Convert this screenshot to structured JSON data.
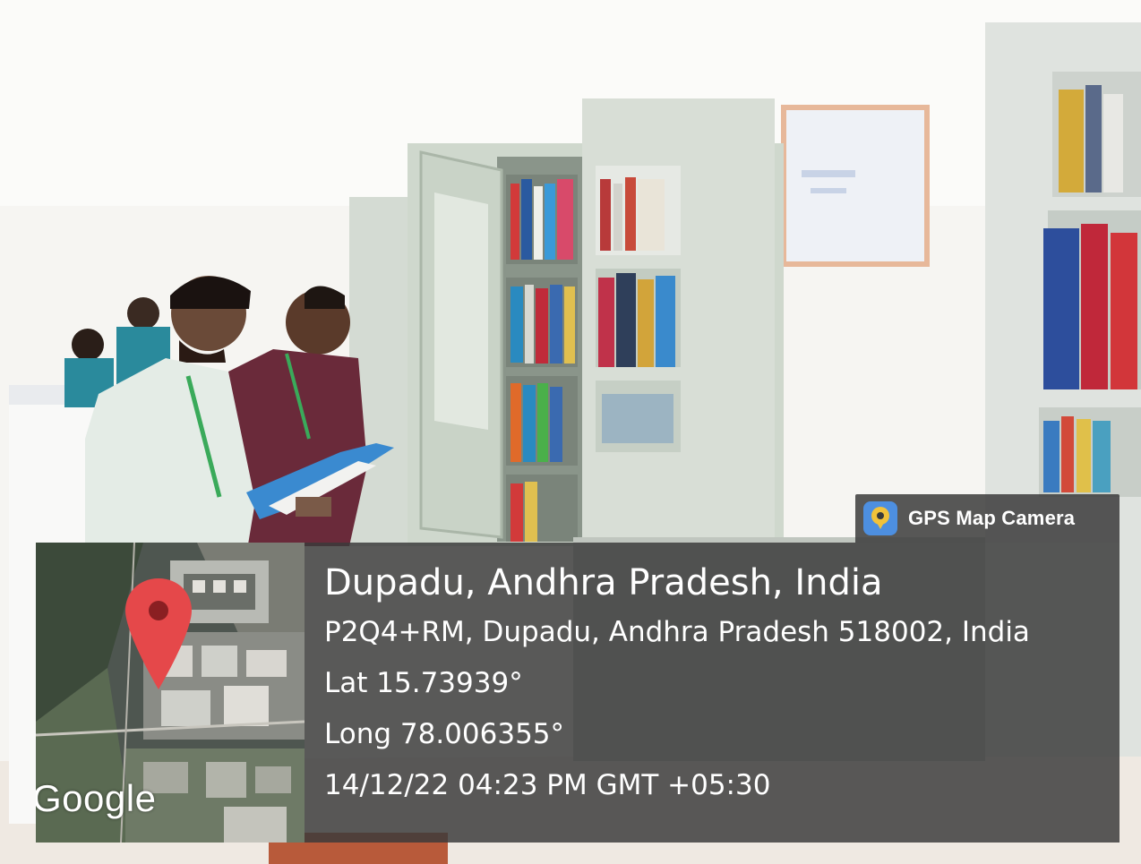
{
  "badge": {
    "label": "GPS Map Camera",
    "icon": "gps-map-camera-app-icon"
  },
  "map": {
    "logo_text": "Google",
    "pin_icon": "location-pin-icon",
    "pin_color": "#e5484a"
  },
  "location": {
    "title": "Dupadu, Andhra Pradesh, India",
    "address": "P2Q4+RM, Dupadu, Andhra Pradesh 518002, India",
    "latitude": "Lat 15.73939°",
    "longitude": "Long 78.006355°",
    "datetime": "14/12/22 04:23 PM GMT +05:30"
  },
  "colors": {
    "panel": "#3a3a3a",
    "text": "#ffffff",
    "badge_icon_bg": "#4d8fe0",
    "badge_icon_ring": "#f2c23a"
  }
}
